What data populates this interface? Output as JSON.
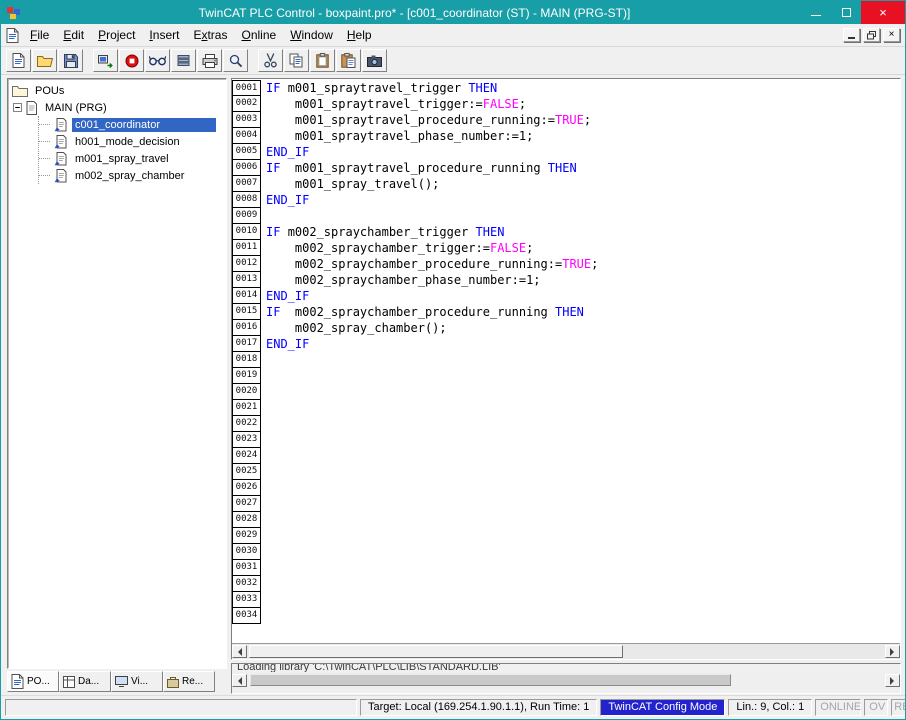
{
  "window": {
    "title": "TwinCAT PLC Control - boxpaint.pro* - [c001_coordinator (ST) - MAIN (PRG-ST)]"
  },
  "menu": {
    "items": [
      {
        "label": "File",
        "u": 0
      },
      {
        "label": "Edit",
        "u": 0
      },
      {
        "label": "Project",
        "u": 0
      },
      {
        "label": "Insert",
        "u": 0
      },
      {
        "label": "Extras",
        "u": 1
      },
      {
        "label": "Online",
        "u": 0
      },
      {
        "label": "Window",
        "u": 0
      },
      {
        "label": "Help",
        "u": 0
      }
    ]
  },
  "toolbar": {
    "groups": [
      [
        {
          "name": "new-file",
          "icon": "page"
        },
        {
          "name": "open-file",
          "icon": "folder-open"
        },
        {
          "name": "save",
          "icon": "floppy"
        }
      ],
      [
        {
          "name": "login",
          "icon": "login"
        },
        {
          "name": "stop",
          "icon": "stop"
        },
        {
          "name": "monitoring",
          "icon": "glasses"
        },
        {
          "name": "breakpoints",
          "icon": "bars"
        },
        {
          "name": "print",
          "icon": "printer"
        },
        {
          "name": "find",
          "icon": "magnifier"
        }
      ],
      [
        {
          "name": "cut",
          "icon": "scissors"
        },
        {
          "name": "copy",
          "icon": "copy"
        },
        {
          "name": "paste",
          "icon": "clipboard"
        },
        {
          "name": "paste-special",
          "icon": "clipboard-page"
        },
        {
          "name": "snapshot",
          "icon": "camera"
        }
      ]
    ]
  },
  "tree": {
    "root": "POUs",
    "program": "MAIN (PRG)",
    "children": [
      {
        "label": "c001_coordinator",
        "selected": true
      },
      {
        "label": "h001_mode_decision"
      },
      {
        "label": "m001_spray_travel"
      },
      {
        "label": "m002_spray_chamber"
      }
    ]
  },
  "left_tabs": [
    {
      "label": "PO...",
      "name": "tab-pous",
      "icon": "page",
      "active": true
    },
    {
      "label": "Da...",
      "name": "tab-data-types",
      "icon": "datatypes"
    },
    {
      "label": "Vi...",
      "name": "tab-visualizations",
      "icon": "visu"
    },
    {
      "label": "Re...",
      "name": "tab-resources",
      "icon": "resources"
    }
  ],
  "editor": {
    "lines": [
      {
        "n": "0001",
        "s": [
          [
            "IF ",
            "k"
          ],
          [
            "m001_spraytravel_trigger ",
            "t"
          ],
          [
            "THEN",
            "k"
          ]
        ]
      },
      {
        "n": "0002",
        "s": [
          [
            "    m001_spraytravel_trigger:=",
            "t"
          ],
          [
            "FALSE",
            "c"
          ],
          [
            ";",
            "t"
          ]
        ]
      },
      {
        "n": "0003",
        "s": [
          [
            "    m001_spraytravel_procedure_running:=",
            "t"
          ],
          [
            "TRUE",
            "c"
          ],
          [
            ";",
            "t"
          ]
        ]
      },
      {
        "n": "0004",
        "s": [
          [
            "    m001_spraytravel_phase_number:=1;",
            "t"
          ]
        ]
      },
      {
        "n": "0005",
        "s": [
          [
            "END_IF",
            "k"
          ]
        ]
      },
      {
        "n": "0006",
        "s": [
          [
            "IF  ",
            "k"
          ],
          [
            "m001_spraytravel_procedure_running ",
            "t"
          ],
          [
            "THEN",
            "k"
          ]
        ]
      },
      {
        "n": "0007",
        "s": [
          [
            "    m001_spray_travel();",
            "t"
          ]
        ]
      },
      {
        "n": "0008",
        "s": [
          [
            "END_IF",
            "k"
          ]
        ]
      },
      {
        "n": "0009",
        "s": []
      },
      {
        "n": "0010",
        "s": [
          [
            "IF ",
            "k"
          ],
          [
            "m002_spraychamber_trigger ",
            "t"
          ],
          [
            "THEN",
            "k"
          ]
        ]
      },
      {
        "n": "0011",
        "s": [
          [
            "    m002_spraychamber_trigger:=",
            "t"
          ],
          [
            "FALSE",
            "c"
          ],
          [
            ";",
            "t"
          ]
        ]
      },
      {
        "n": "0012",
        "s": [
          [
            "    m002_spraychamber_procedure_running:=",
            "t"
          ],
          [
            "TRUE",
            "c"
          ],
          [
            ";",
            "t"
          ]
        ]
      },
      {
        "n": "0013",
        "s": [
          [
            "    m002_spraychamber_phase_number:=1;",
            "t"
          ]
        ]
      },
      {
        "n": "0014",
        "s": [
          [
            "END_IF",
            "k"
          ]
        ]
      },
      {
        "n": "0015",
        "s": [
          [
            "IF  ",
            "k"
          ],
          [
            "m002_spraychamber_procedure_running ",
            "t"
          ],
          [
            "THEN",
            "k"
          ]
        ]
      },
      {
        "n": "0016",
        "s": [
          [
            "    m002_spray_chamber();",
            "t"
          ]
        ]
      },
      {
        "n": "0017",
        "s": [
          [
            "END_IF",
            "k"
          ]
        ]
      },
      {
        "n": "0018",
        "s": []
      },
      {
        "n": "0019",
        "s": []
      },
      {
        "n": "0020",
        "s": []
      },
      {
        "n": "0021",
        "s": []
      },
      {
        "n": "0022",
        "s": []
      },
      {
        "n": "0023",
        "s": []
      },
      {
        "n": "0024",
        "s": []
      },
      {
        "n": "0025",
        "s": []
      },
      {
        "n": "0026",
        "s": []
      },
      {
        "n": "0027",
        "s": []
      },
      {
        "n": "0028",
        "s": []
      },
      {
        "n": "0029",
        "s": []
      },
      {
        "n": "0030",
        "s": []
      },
      {
        "n": "0031",
        "s": []
      },
      {
        "n": "0032",
        "s": []
      },
      {
        "n": "0033",
        "s": []
      },
      {
        "n": "0034",
        "s": []
      }
    ]
  },
  "messages": {
    "line": "Loading library 'C:\\TwinCAT\\PLC\\LIB\\STANDARD.LIB'"
  },
  "status": {
    "target": "Target: Local (169.254.1.90.1.1), Run Time: 1",
    "mode": "TwinCAT Config Mode",
    "position": "Lin.: 9, Col.: 1",
    "flags": [
      "ONLINE",
      "OV",
      "READ"
    ]
  },
  "colors": {
    "titlebar": "#189ea7",
    "close_button": "#e81123",
    "selection": "#3166c4",
    "keyword": "#0000ff",
    "constant": "#ff00ff",
    "config_mode_bg": "#2323cd",
    "disabled_text": "#a6a6a6"
  }
}
